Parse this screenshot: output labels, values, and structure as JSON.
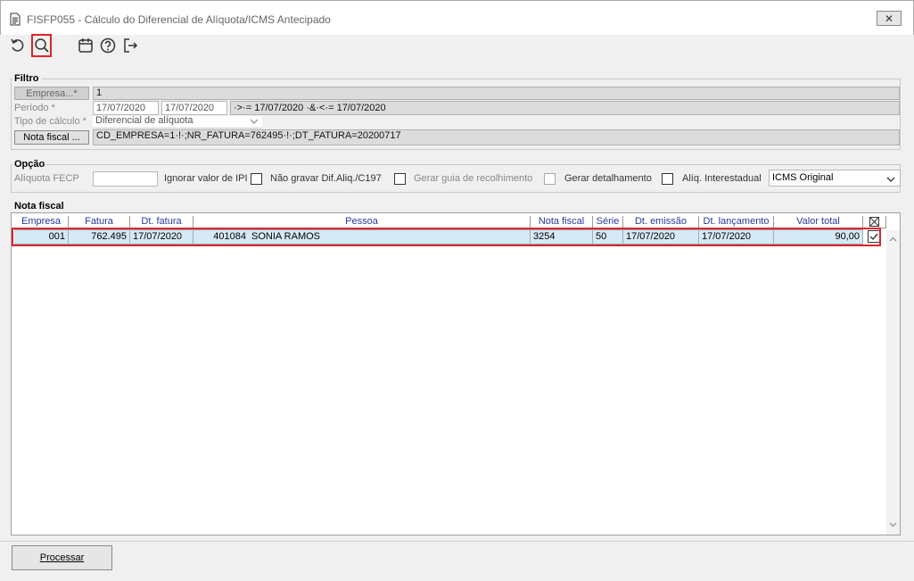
{
  "window": {
    "title": "FISFP055 - Cálculo do Diferencial de Alíquota/ICMS Antecipado",
    "close_label": "✕"
  },
  "toolbar": {
    "icons": [
      "undo-icon",
      "search-icon",
      "calendar-icon",
      "help-icon",
      "exit-icon"
    ]
  },
  "filtro": {
    "label": "Filtro",
    "empresa_button": "Empresa...*",
    "empresa_value": "1",
    "periodo_label": "Período *",
    "periodo_from": "17/07/2020",
    "periodo_to": "17/07/2020",
    "periodo_expr": "·>·= 17/07/2020 ·&·<·= 17/07/2020",
    "tipo_label": "Tipo de cálculo *",
    "tipo_value": "Diferencial de alíquota",
    "nota_button": "Nota fiscal ...",
    "nota_expr": "CD_EMPRESA=1·!·;NR_FATURA=762495·!·;DT_FATURA=20200717"
  },
  "opcao": {
    "label": "Opção",
    "aliquota_fecp_label": "Alíquota FECP",
    "aliquota_fecp_value": "",
    "ignorar_ipi_label": "Ignorar valor de IPI",
    "nao_gravar_label": "Não gravar Dif.Aliq./C197",
    "gerar_guia_label": "Gerar guia de recolhimento",
    "gerar_detalhamento_label": "Gerar detalhamento",
    "aliq_interestadual_label": "Alíq. Interestadual",
    "icms_select": "ICMS Original"
  },
  "nota_fiscal": {
    "label": "Nota fiscal",
    "columns": [
      "Empresa",
      "Fatura",
      "Dt. fatura",
      "Pessoa",
      "Nota fiscal",
      "Série",
      "Dt. emissão",
      "Dt. lançamento",
      "Valor total"
    ],
    "rows": [
      {
        "empresa": "001",
        "fatura": "762.495",
        "dt_fatura": "17/07/2020",
        "pessoa_code": "401084",
        "pessoa_name": "SONIA RAMOS",
        "nota_fiscal": "3254",
        "serie": "50",
        "dt_emissao": "17/07/2020",
        "dt_lancamento": "17/07/2020",
        "valor_total": "90,00",
        "checked": true
      }
    ]
  },
  "footer": {
    "processar_button": "Processar"
  },
  "colors": {
    "highlight": "#e0242c",
    "row_selected": "#d6e9f6",
    "header_text": "#2a3a9a"
  }
}
